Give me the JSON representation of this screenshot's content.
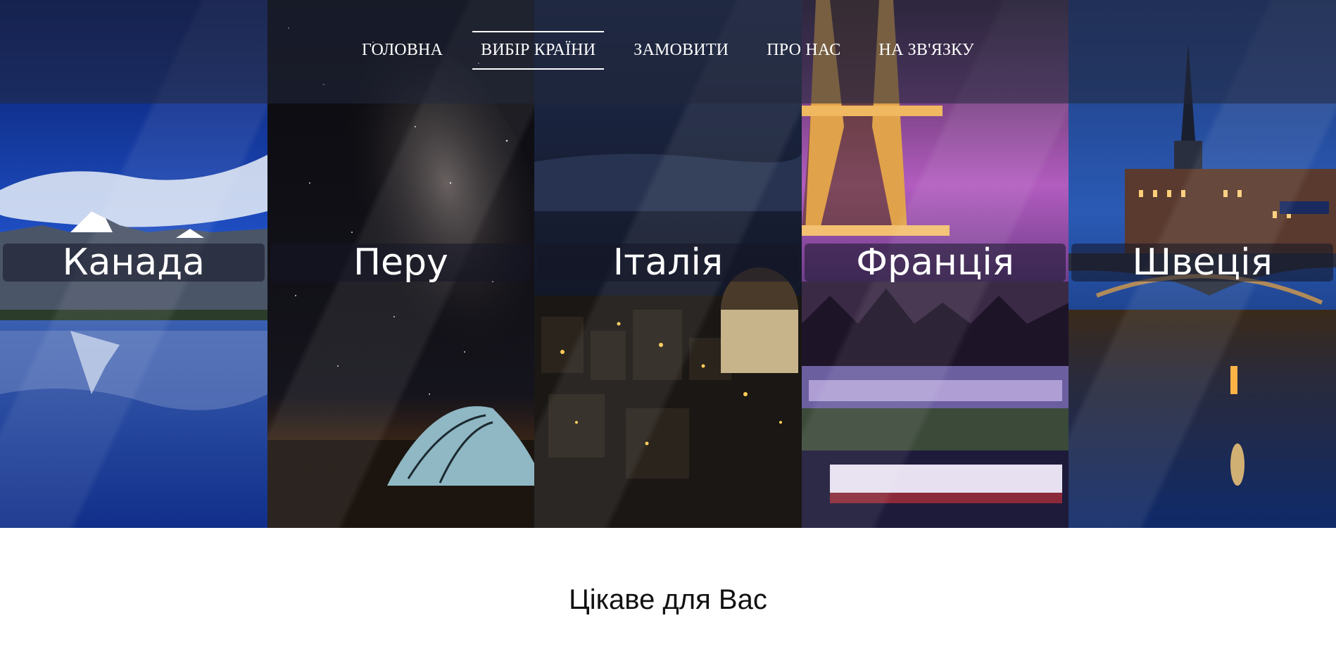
{
  "nav": {
    "items": [
      {
        "label": "ГОЛОВНА",
        "active": false
      },
      {
        "label": "ВИБІР КРАЇНИ",
        "active": true
      },
      {
        "label": "ЗАМОВИТИ",
        "active": false
      },
      {
        "label": "ПРО НАС",
        "active": false
      },
      {
        "label": "НА ЗВ'ЯЗКУ",
        "active": false
      }
    ]
  },
  "countries": [
    {
      "name": "Канада",
      "photo": "mountain-lake-reflection"
    },
    {
      "name": "Перу",
      "photo": "milky-way-tent"
    },
    {
      "name": "Італія",
      "photo": "night-city-dome"
    },
    {
      "name": "Франція",
      "photo": "eiffel-tower-night"
    },
    {
      "name": "Швеція",
      "photo": "stockholm-night-bridge"
    }
  ],
  "section": {
    "title": "Цікаве для Вас"
  },
  "colors": {
    "navbar_bg": "#22283C",
    "label_bg": "#141626",
    "text_light": "#FFFFFF",
    "text_dark": "#111111"
  }
}
